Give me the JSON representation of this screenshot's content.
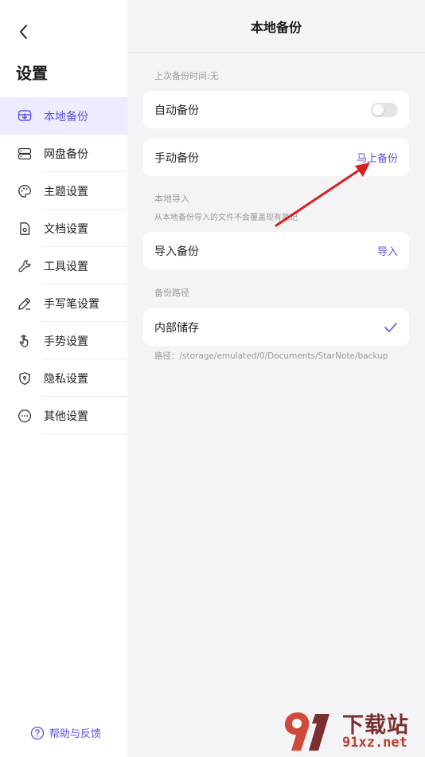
{
  "sidebar": {
    "title": "设置",
    "items": [
      {
        "label": "本地备份",
        "icon": "local-backup-icon"
      },
      {
        "label": "网盘备份",
        "icon": "cloud-drive-icon"
      },
      {
        "label": "主题设置",
        "icon": "palette-icon"
      },
      {
        "label": "文档设置",
        "icon": "document-gear-icon"
      },
      {
        "label": "工具设置",
        "icon": "wrench-icon"
      },
      {
        "label": "手写笔设置",
        "icon": "pen-icon"
      },
      {
        "label": "手势设置",
        "icon": "hand-pointer-icon"
      },
      {
        "label": "隐私设置",
        "icon": "shield-lock-icon"
      },
      {
        "label": "其他设置",
        "icon": "more-dots-icon"
      }
    ],
    "help_label": "帮助与反馈"
  },
  "main": {
    "title": "本地备份",
    "last_backup_label": "上次备份时间:无",
    "auto_backup": {
      "label": "自动备份",
      "enabled": false
    },
    "manual_backup": {
      "label": "手动备份",
      "action": "马上备份"
    },
    "local_import_section": "本地导入",
    "local_import_note": "从本地备份导入的文件不会覆盖现有笔记",
    "import_backup": {
      "label": "导入备份",
      "action": "导入"
    },
    "backup_path_section": "备份路径",
    "internal_storage": {
      "label": "内部储存",
      "selected": true
    },
    "path_note": "路径：/storage/emulated/0/Documents/StarNote/backup"
  },
  "watermark": {
    "line1": "下载站",
    "line2": "91xz.net"
  },
  "colors": {
    "accent": "#5b54e0",
    "active_bg": "#ecebff",
    "arrow": "#d62020"
  }
}
